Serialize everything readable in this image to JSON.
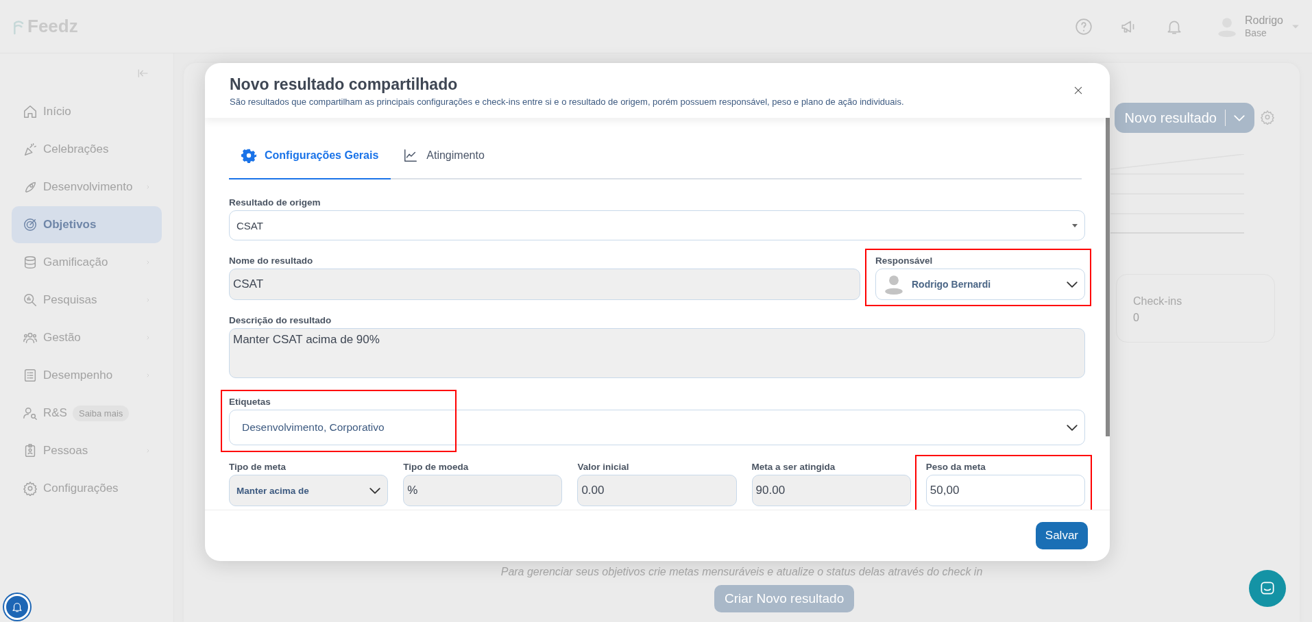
{
  "app": {
    "logo": "Feedz",
    "topbar": {
      "user_name": "Rodrigo",
      "user_role": "Base"
    },
    "sidebar": {
      "items": [
        {
          "label": "Início",
          "selected": false,
          "submenu": false
        },
        {
          "label": "Celebrações",
          "selected": false,
          "submenu": false
        },
        {
          "label": "Desenvolvimento",
          "selected": false,
          "submenu": true
        },
        {
          "label": "Objetivos",
          "selected": true,
          "submenu": false
        },
        {
          "label": "Gamificação",
          "selected": false,
          "submenu": true
        },
        {
          "label": "Pesquisas",
          "selected": false,
          "submenu": true
        },
        {
          "label": "Gestão",
          "selected": false,
          "submenu": true
        },
        {
          "label": "Desempenho",
          "selected": false,
          "submenu": true
        },
        {
          "label": "R&S",
          "selected": false,
          "submenu": false,
          "badge": "Saiba mais"
        },
        {
          "label": "Pessoas",
          "selected": false,
          "submenu": true
        },
        {
          "label": "Configurações",
          "selected": false,
          "submenu": false
        }
      ]
    },
    "main": {
      "new_button": "Novo resultado",
      "checkins_label": "Check-ins",
      "checkins_value": "0",
      "empty_text": "Para gerenciar seus objetivos crie metas mensuráveis e atualize o status delas através do check in",
      "create_button": "Criar Novo resultado"
    }
  },
  "modal": {
    "title": "Novo resultado compartilhado",
    "subtitle": "São resultados que compartilham as principais configurações e check-ins entre si e o resultado de origem, porém possuem responsável, peso e plano de ação individuais.",
    "tabs": [
      {
        "label": "Configurações Gerais",
        "selected": true
      },
      {
        "label": "Atingimento",
        "selected": false
      }
    ],
    "origin": {
      "label": "Resultado de origem",
      "value": "CSAT"
    },
    "name": {
      "label": "Nome do resultado",
      "value": "CSAT"
    },
    "owner": {
      "label": "Responsável",
      "value": "Rodrigo Bernardi",
      "highlighted": true
    },
    "description": {
      "label": "Descrição do resultado",
      "value": "Manter CSAT acima de 90%"
    },
    "tags": {
      "label": "Etiquetas",
      "value": "Desenvolvimento, Corporativo",
      "highlighted": true
    },
    "goal_fields": [
      {
        "kind": "select",
        "label": "Tipo de meta",
        "value": "Manter acima de",
        "highlighted": false
      },
      {
        "kind": "readonly",
        "label": "Tipo de moeda",
        "value": "%",
        "highlighted": false
      },
      {
        "kind": "readonly",
        "label": "Valor inicial",
        "value": "0.00",
        "highlighted": false
      },
      {
        "kind": "readonly",
        "label": "Meta a ser atingida",
        "value": "90.00",
        "highlighted": false
      },
      {
        "kind": "input",
        "label": "Peso da meta",
        "value": "50,00",
        "highlighted": true
      }
    ],
    "save_button": "Salvar"
  }
}
